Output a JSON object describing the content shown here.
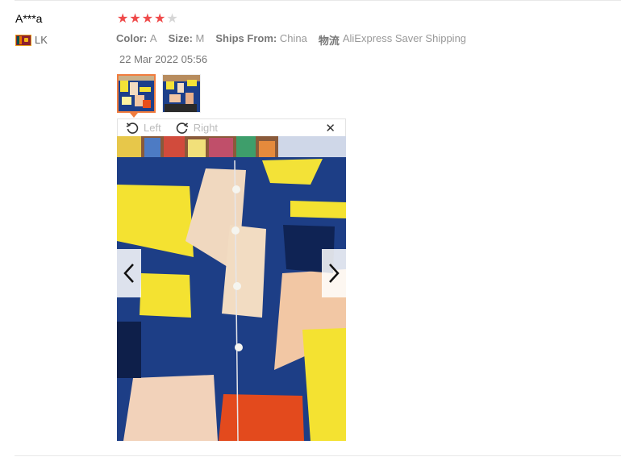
{
  "review": {
    "user_name": "A***a",
    "country_code": "LK",
    "rating": 4,
    "rating_max": 5,
    "color_label": "Color:",
    "color_value": "A",
    "size_label": "Size:",
    "size_value": "M",
    "ships_from_label": "Ships From:",
    "ships_from_value": "China",
    "logistics_label": "物流",
    "logistics_value": "AliExpress Saver Shipping",
    "date": "22 Mar 2022 05:56"
  },
  "viewer": {
    "rotate_left_label": "Left",
    "rotate_right_label": "Right",
    "close_glyph": "✕",
    "selected_thumbnail": 1,
    "icons": [
      "rotate-left-icon",
      "rotate-right-icon",
      "close-icon",
      "chevron-left-icon",
      "chevron-right-icon"
    ]
  },
  "colors": {
    "star_on": "#ef4a4a",
    "star_off": "#d6d6d6",
    "thumb_selected_border": "#f07c3e"
  }
}
